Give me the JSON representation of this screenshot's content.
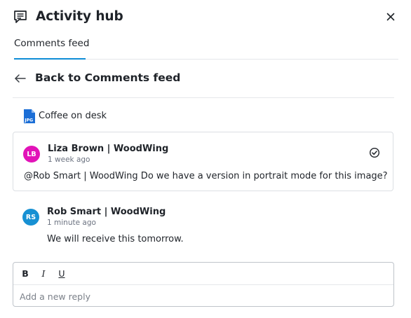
{
  "header": {
    "title": "Activity hub",
    "icon": "comment-icon",
    "close_icon": "close-icon"
  },
  "tabs": [
    {
      "label": "Comments feed",
      "active": true
    }
  ],
  "back": {
    "label": "Back to Comments feed",
    "icon": "arrow-left-icon"
  },
  "file": {
    "name": "Coffee on desk",
    "type": "JPG",
    "icon": "jpg-file-icon"
  },
  "thread": {
    "comment": {
      "initials": "LB",
      "avatar_color": "#e213b8",
      "author": "Liza Brown | WoodWing",
      "time": "1 week ago",
      "text": "@Rob Smart | WoodWing Do we have a version in portrait mode for this image?",
      "resolve_icon": "check-circle-icon"
    },
    "reply": {
      "initials": "RS",
      "avatar_color": "#1790d3",
      "author": "Rob Smart | WoodWing",
      "time": "1 minute ago",
      "text": "We will receive this tomorrow."
    }
  },
  "editor": {
    "toolbar": {
      "bold": "B",
      "italic": "I",
      "underline": "U"
    },
    "placeholder": "Add a new reply"
  },
  "colors": {
    "accent": "#0f8dd6",
    "border": "#dcdfe3"
  }
}
